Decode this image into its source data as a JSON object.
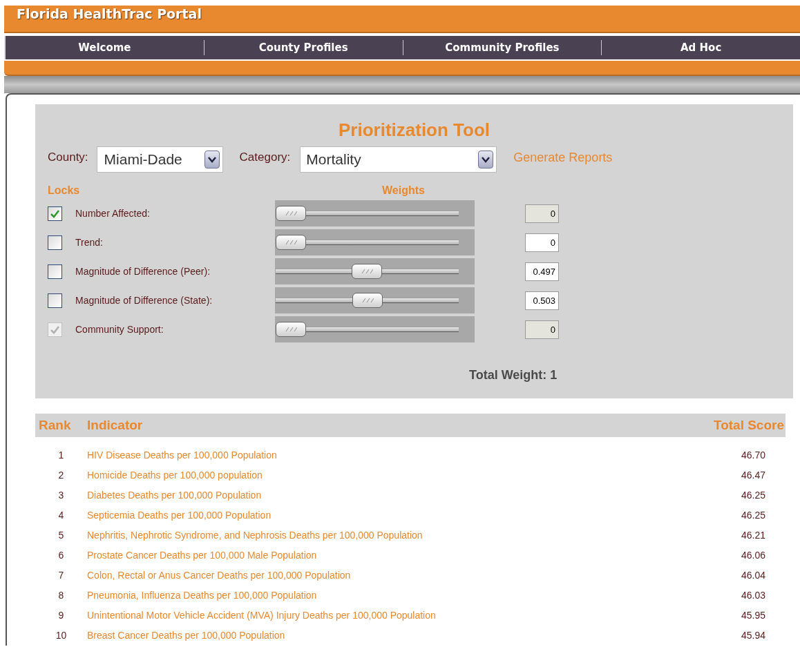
{
  "header": {
    "title": "Florida HealthTrac Portal"
  },
  "nav": [
    {
      "label": "Welcome"
    },
    {
      "label": "County Profiles"
    },
    {
      "label": "Community Profiles"
    },
    {
      "label": "Ad Hoc"
    }
  ],
  "tool": {
    "title": "Prioritization Tool",
    "county": {
      "label": "County:",
      "value": "Miami-Dade"
    },
    "category": {
      "label": "Category:",
      "value": "Mortality"
    },
    "link": "Generate Reports",
    "locks_heading": "Locks",
    "weights_heading": "Weights",
    "weights": [
      {
        "name": "Number Affected:",
        "checked": true,
        "disabled": false,
        "level": 0,
        "value": "0",
        "value_disabled": true
      },
      {
        "name": "Trend:",
        "checked": false,
        "disabled": false,
        "level": 0,
        "value": "0",
        "value_disabled": false
      },
      {
        "name": "Magnitude of Difference (Peer):",
        "checked": false,
        "disabled": false,
        "level": 0.497,
        "value": "0.497",
        "value_disabled": false
      },
      {
        "name": "Magnitude of Difference (State):",
        "checked": false,
        "disabled": false,
        "level": 0.503,
        "value": "0.503",
        "value_disabled": false
      },
      {
        "name": "Community Support:",
        "checked": true,
        "disabled": true,
        "level": 0,
        "value": "0",
        "value_disabled": true
      }
    ],
    "total": "Total Weight: 1"
  },
  "table": {
    "columns": [
      "Rank",
      "Indicator",
      "Total Score"
    ],
    "rows": [
      {
        "rank": "1",
        "indicator": "HIV Disease Deaths per 100,000 Population",
        "score": "46.70"
      },
      {
        "rank": "2",
        "indicator": "Homicide Deaths per 100,000 population",
        "score": "46.47"
      },
      {
        "rank": "3",
        "indicator": "Diabetes Deaths per 100,000 Population",
        "score": "46.25"
      },
      {
        "rank": "4",
        "indicator": "Septicemia Deaths per 100,000 Population",
        "score": "46.25"
      },
      {
        "rank": "5",
        "indicator": "Nephritis, Nephrotic Syndrome, and Nephrosis Deaths per 100,000 Population",
        "score": "46.21"
      },
      {
        "rank": "6",
        "indicator": "Prostate Cancer Deaths per 100,000 Male Population",
        "score": "46.06"
      },
      {
        "rank": "7",
        "indicator": "Colon, Rectal or Anus Cancer Deaths per 100,000 Population",
        "score": "46.04"
      },
      {
        "rank": "8",
        "indicator": "Pneumonia, Influenza Deaths per 100,000 Population",
        "score": "46.03"
      },
      {
        "rank": "9",
        "indicator": "Unintentional Motor Vehicle Accident (MVA) Injury Deaths per 100,000 Population",
        "score": "45.95"
      },
      {
        "rank": "10",
        "indicator": "Breast Cancer Deaths per 100,000 Population",
        "score": "45.94"
      }
    ]
  }
}
